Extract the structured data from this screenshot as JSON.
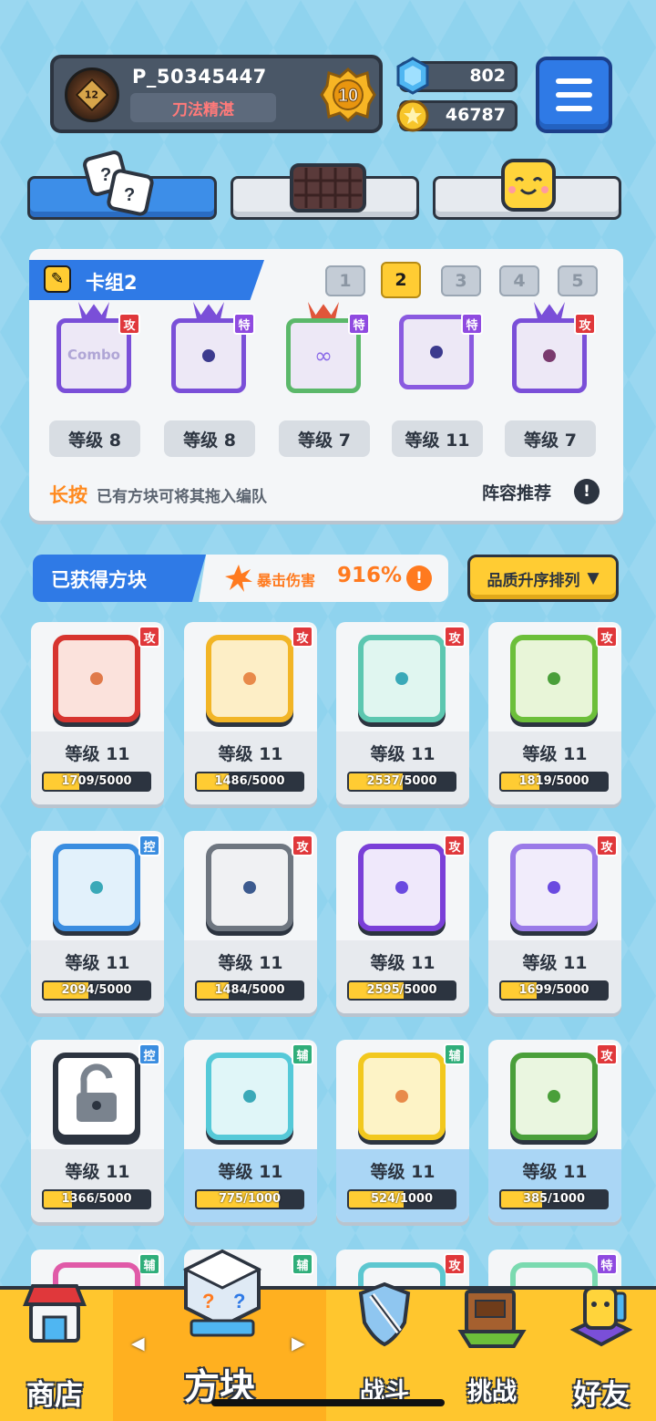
{
  "profile": {
    "player_id": "P_50345447",
    "avatar_level": "12",
    "title": "刀法精湛",
    "rank": "10"
  },
  "currency": {
    "gems": "802",
    "coins": "46787"
  },
  "deck": {
    "label": "卡组2",
    "numbers": [
      "1",
      "2",
      "3",
      "4",
      "5"
    ],
    "active_index": 1,
    "cards": [
      {
        "tag": "攻",
        "level": "等级 8",
        "logo_text": "Combo",
        "color": "#7a4fd8"
      },
      {
        "tag": "特",
        "level": "等级 8",
        "color": "#6a45c8"
      },
      {
        "tag": "特",
        "level": "等级 7",
        "color": "#7a4fd8"
      },
      {
        "tag": "特",
        "level": "等级 11",
        "color": "#8a5ae0"
      },
      {
        "tag": "攻",
        "level": "等级 7",
        "color": "#7a4fd8"
      }
    ],
    "hint_highlight": "长按",
    "hint_text": "已有方块可将其拖入编队",
    "recommend_label": "阵容推荐",
    "recommend_icon": "!"
  },
  "owned": {
    "title": "已获得方块",
    "crit_label": "暴击伤害",
    "crit_value": "916%",
    "crit_info_icon": "!",
    "sort_label": "品质升序排列",
    "sort_arrow": "▼"
  },
  "blocks": [
    {
      "tag": "攻",
      "level": "等级 11",
      "progress": "1709/5000",
      "fill": 0.34,
      "border": "#d7342f",
      "bg": "#fbe2dc",
      "dot": "#e07a4a",
      "blue": false
    },
    {
      "tag": "攻",
      "level": "等级 11",
      "progress": "1486/5000",
      "fill": 0.3,
      "border": "#f2b526",
      "bg": "#fdeec6",
      "dot": "#e88a4a",
      "blue": false
    },
    {
      "tag": "攻",
      "level": "等级 11",
      "progress": "2537/5000",
      "fill": 0.51,
      "border": "#5cc7b0",
      "bg": "#e0f6f0",
      "dot": "#3aa9b8",
      "blue": false
    },
    {
      "tag": "攻",
      "level": "等级 11",
      "progress": "1819/5000",
      "fill": 0.36,
      "border": "#6cbf3a",
      "bg": "#e8f5d8",
      "dot": "#4a9f3a",
      "blue": false
    },
    {
      "tag": "控",
      "level": "等级 11",
      "progress": "2094/5000",
      "fill": 0.42,
      "border": "#3a8de0",
      "bg": "#e2f1fb",
      "dot": "#3aa9b8",
      "blue": false
    },
    {
      "tag": "攻",
      "level": "等级 11",
      "progress": "1484/5000",
      "fill": 0.3,
      "border": "#6e7680",
      "bg": "#f0f1f3",
      "dot": "#3c5a8e",
      "blue": false
    },
    {
      "tag": "攻",
      "level": "等级 11",
      "progress": "2595/5000",
      "fill": 0.52,
      "border": "#7a3fd8",
      "bg": "#efe8fb",
      "dot": "#6a4ae0",
      "blue": false
    },
    {
      "tag": "攻",
      "level": "等级 11",
      "progress": "1699/5000",
      "fill": 0.34,
      "border": "#9a7ae8",
      "bg": "#f1ecfb",
      "dot": "#6a4ae0",
      "blue": false
    },
    {
      "tag": "控",
      "level": "等级 11",
      "progress": "1366/5000",
      "fill": 0.27,
      "border": "#2c3440",
      "bg": "#ffffff",
      "dot": "#2c3440",
      "blue": false,
      "locked": true
    },
    {
      "tag": "辅",
      "level": "等级 11",
      "progress": "775/1000",
      "fill": 0.78,
      "border": "#55c9d8",
      "bg": "#e0f6f8",
      "dot": "#3aa9b8",
      "blue": true
    },
    {
      "tag": "辅",
      "level": "等级 11",
      "progress": "524/1000",
      "fill": 0.52,
      "border": "#f2c81e",
      "bg": "#fdf3c6",
      "dot": "#e88a4a",
      "blue": true
    },
    {
      "tag": "攻",
      "level": "等级 11",
      "progress": "385/1000",
      "fill": 0.39,
      "border": "#4a9f3a",
      "bg": "#eaf6e0",
      "dot": "#4a9f3a",
      "blue": true
    }
  ],
  "partial_row_tags": [
    "辅",
    "辅",
    "攻",
    "特"
  ],
  "nav": {
    "items": [
      {
        "label": "商店",
        "icon": "shop-icon"
      },
      {
        "label": "方块",
        "icon": "dice-box-icon"
      },
      {
        "label": "战斗",
        "icon": "battle-icon"
      },
      {
        "label": "挑战",
        "icon": "challenge-icon"
      },
      {
        "label": "好友",
        "icon": "friends-icon"
      }
    ],
    "active": 1
  }
}
